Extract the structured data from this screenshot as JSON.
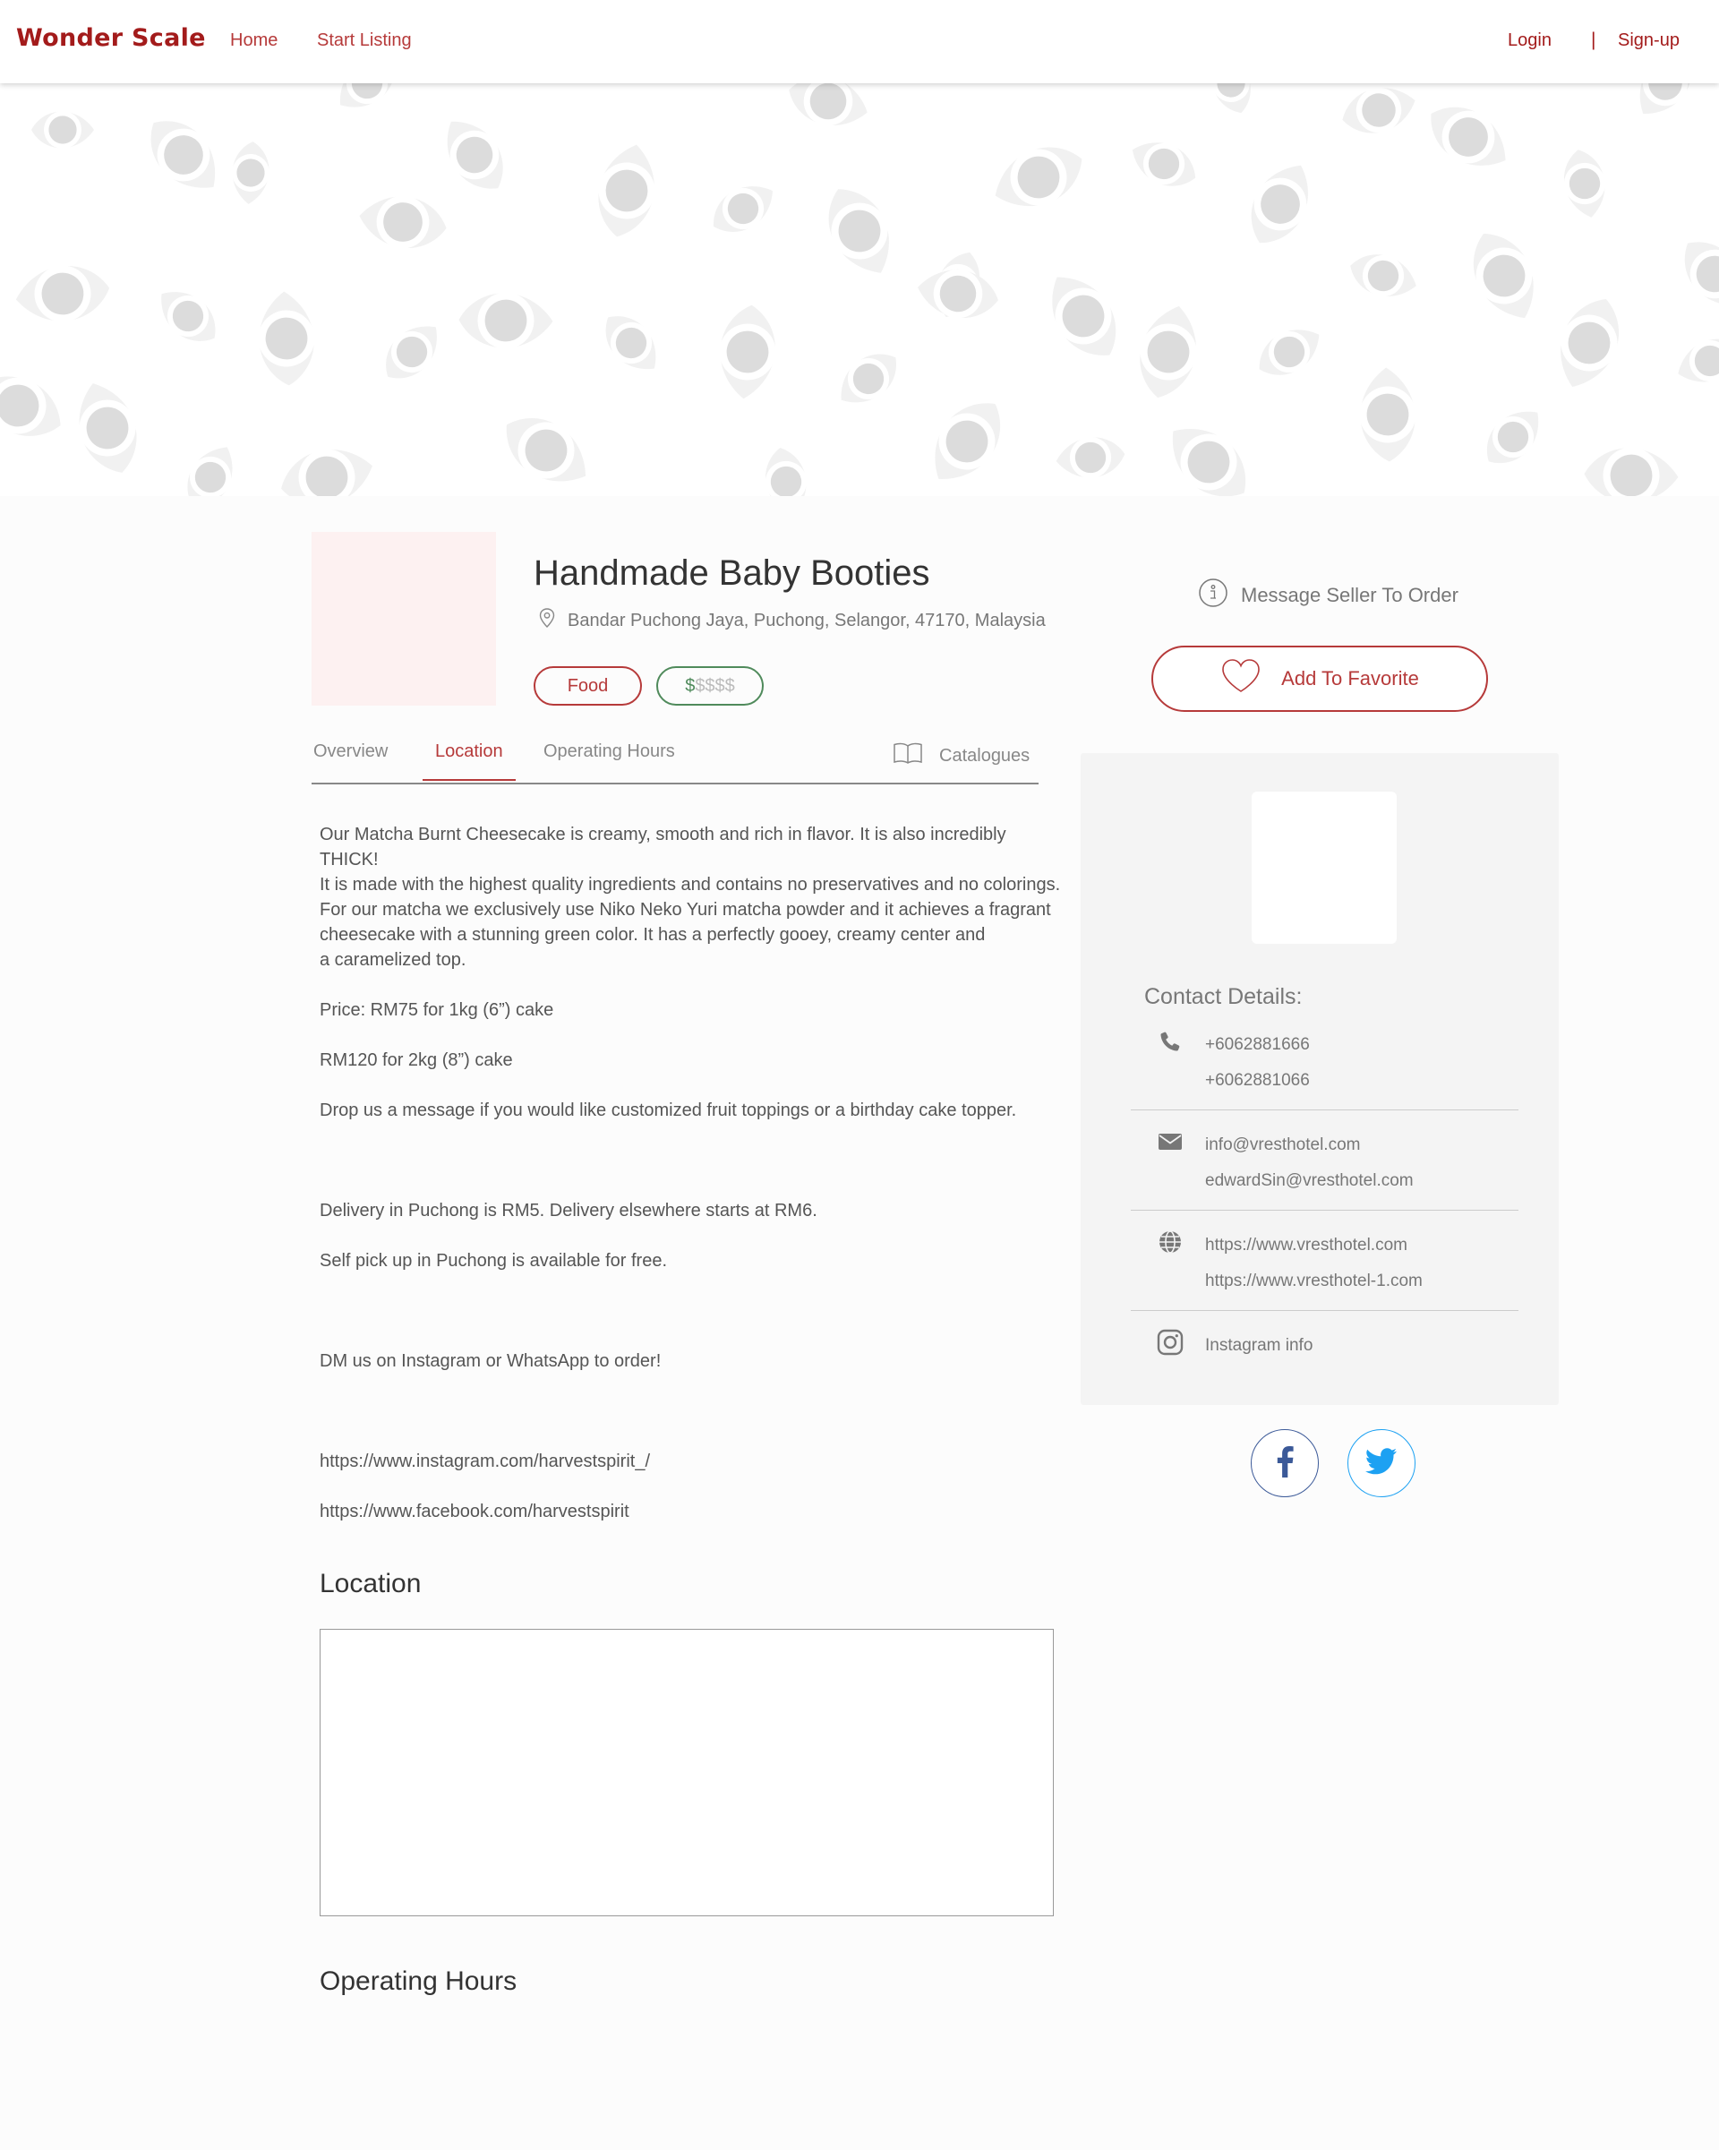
{
  "nav": {
    "brand": "Wonder Scale",
    "home": "Home",
    "start_listing": "Start Listing",
    "login": "Login",
    "separator": "|",
    "signup": "Sign-up"
  },
  "listing": {
    "title": "Handmade Baby Booties",
    "address": "Bandar Puchong Jaya, Puchong, Selangor, 47170, Malaysia",
    "category_tag": "Food",
    "price_level_active": "$",
    "price_level_inactive": "$$$$"
  },
  "tabs": {
    "overview": "Overview",
    "location": "Location",
    "operating_hours": "Operating Hours",
    "catalogues": "Catalogues"
  },
  "description": {
    "paragraph_lines": [
      "Our Matcha Burnt Cheesecake is creamy, smooth and rich in flavor. It is also incredibly THICK!",
      "It is made with the highest quality ingredients and contains no preservatives and no colorings.",
      "For our matcha we exclusively use Niko Neko Yuri matcha powder and it achieves a fragrant",
      "cheesecake with a stunning green color. It has a perfectly gooey, creamy center and",
      "a caramelized top."
    ],
    "price_1": "Price: RM75 for 1kg (6”) cake",
    "price_2": "RM120 for 2kg (8”) cake",
    "message_note": "Drop us a message if you would like customized fruit toppings or a birthday cake topper.",
    "delivery": "Delivery in Puchong is RM5. Delivery elsewhere starts at RM6.",
    "pickup": "Self pick up in Puchong is available for free.",
    "order_note": "DM us on Instagram or WhatsApp to order!",
    "instagram_url": "https://www.instagram.com/harvestspirit_/",
    "facebook_url": "https://www.facebook.com/harvestspirit"
  },
  "sections": {
    "location": "Location",
    "operating_hours": "Operating Hours"
  },
  "sidebar": {
    "message_seller": "Message Seller To Order",
    "add_favorite": "Add To Favorite",
    "contact_title": "Contact Details:",
    "phones": [
      "+6062881666",
      "+6062881066"
    ],
    "emails": [
      "info@vresthotel.com",
      "edwardSin@vresthotel.com"
    ],
    "websites": [
      "https://www.vresthotel.com",
      "https://www.vresthotel-1.com"
    ],
    "instagram": "Instagram info"
  },
  "icons": {
    "location": "map-pin-icon",
    "catalogue": "open-book-icon",
    "message": "info-icon",
    "favorite": "heart-icon",
    "phone": "phone-icon",
    "email": "envelope-icon",
    "web": "globe-icon",
    "instagram": "instagram-icon",
    "facebook": "facebook-icon",
    "twitter": "twitter-icon"
  },
  "colors": {
    "brand": "#a31b1b",
    "accent": "#b63a3a",
    "price_green": "#4f8a5b",
    "facebook": "#3b5998",
    "twitter": "#1da1f2"
  }
}
